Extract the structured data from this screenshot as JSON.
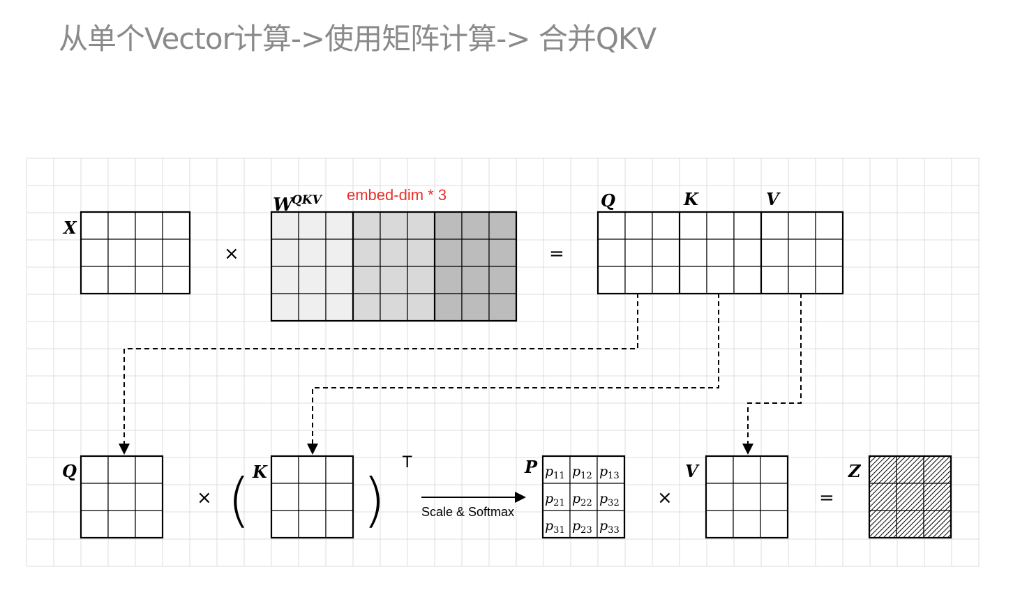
{
  "title": "从单个Vector计算->使用矩阵计算-> 合并QKV",
  "labels": {
    "x": "X",
    "w": "W",
    "w_sup": "QKV",
    "embed_note": "embed-dim * 3",
    "q_top": "Q",
    "k_top": "K",
    "v_top": "V",
    "q_bottom": "Q",
    "k_bottom": "K",
    "transpose": "T",
    "p": "P",
    "v_bottom": "V",
    "z": "Z",
    "arrow_label": "Scale & Softmax"
  },
  "operators": {
    "times_1": "×",
    "equals_1": "=",
    "times_2": "×",
    "paren_open": "(",
    "paren_close": ")",
    "times_3": "×",
    "equals_2": "="
  },
  "p_cells": [
    [
      "p11",
      "p12",
      "p13"
    ],
    [
      "p21",
      "p22",
      "p32"
    ],
    [
      "p31",
      "p23",
      "p33"
    ]
  ],
  "colors": {
    "title": "#8a8a8a",
    "note": "#e8302a",
    "w_light": "#efefef",
    "w_mid": "#d9d9d9",
    "w_dark": "#bcbcbc",
    "grid": "#dcdcdc"
  }
}
